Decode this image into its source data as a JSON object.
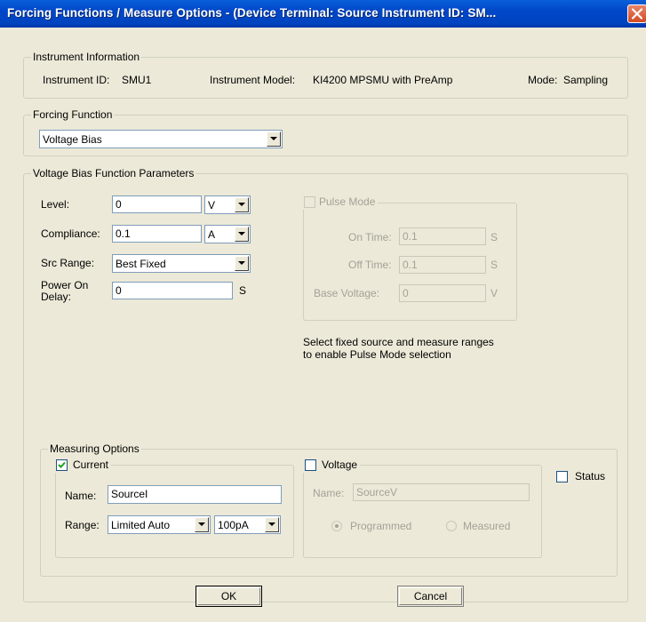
{
  "window": {
    "title": "Forcing Functions / Measure Options - (Device Terminal: Source  Instrument ID: SM..."
  },
  "instrument_info": {
    "legend": "Instrument Information",
    "id_label": "Instrument ID:",
    "id_value": "SMU1",
    "model_label": "Instrument Model:",
    "model_value": "KI4200 MPSMU with PreAmp",
    "mode_label": "Mode:",
    "mode_value": "Sampling"
  },
  "forcing_function": {
    "legend": "Forcing Function",
    "selected": "Voltage Bias"
  },
  "parameters": {
    "legend": "Voltage Bias Function Parameters",
    "level_label": "Level:",
    "level_value": "0",
    "level_unit": "V",
    "compliance_label": "Compliance:",
    "compliance_value": "0.1",
    "compliance_unit": "A",
    "src_range_label": "Src Range:",
    "src_range_value": "Best Fixed",
    "power_on_delay_label_1": "Power On",
    "power_on_delay_label_2": "Delay:",
    "power_on_delay_value": "0",
    "power_on_delay_unit": "S"
  },
  "pulse": {
    "label": "Pulse Mode",
    "checked": false,
    "enabled": false,
    "on_time_label": "On Time:",
    "on_time_value": "0.1",
    "on_time_unit": "S",
    "off_time_label": "Off Time:",
    "off_time_value": "0.1",
    "off_time_unit": "S",
    "base_voltage_label": "Base Voltage:",
    "base_voltage_value": "0",
    "base_voltage_unit": "V",
    "note_line1": "Select fixed source and measure ranges",
    "note_line2": "to enable Pulse Mode selection"
  },
  "measuring": {
    "legend": "Measuring Options",
    "current": {
      "label": "Current",
      "checked": true,
      "name_label": "Name:",
      "name_value": "SourceI",
      "range_label": "Range:",
      "range_mode": "Limited Auto",
      "range_value": "100pA"
    },
    "voltage": {
      "label": "Voltage",
      "checked": false,
      "name_label": "Name:",
      "name_value": "SourceV",
      "programmed_label": "Programmed",
      "measured_label": "Measured",
      "selected": "Programmed"
    },
    "status": {
      "label": "Status",
      "checked": false
    }
  },
  "buttons": {
    "ok": "OK",
    "cancel": "Cancel"
  }
}
